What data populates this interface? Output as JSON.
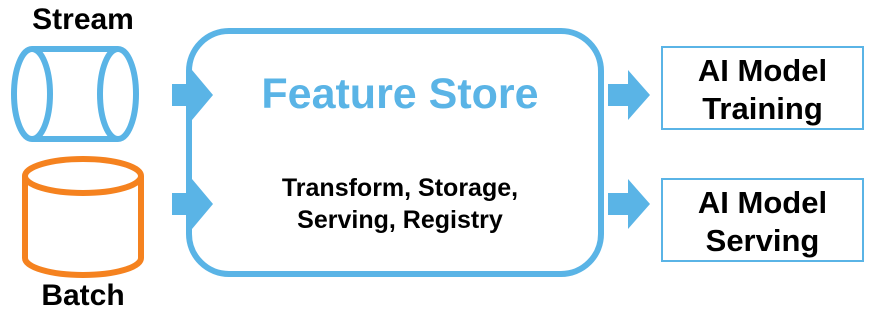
{
  "colors": {
    "stream": "#5ab4e6",
    "batch": "#f5821f",
    "feature_store": "#5ab4e6",
    "arrow": "#5ab4e6",
    "output_border": "#5ab4e6"
  },
  "inputs": {
    "stream_label": "Stream",
    "batch_label": "Batch"
  },
  "feature_store": {
    "title": "Feature Store",
    "desc_line1": "Transform, Storage,",
    "desc_line2": "Serving, Registry"
  },
  "outputs": {
    "training": {
      "line1": "AI Model",
      "line2": "Training"
    },
    "serving": {
      "line1": "AI Model",
      "line2": "Serving"
    }
  },
  "icons": [
    "stream-cylinder-icon",
    "batch-cylinder-icon",
    "arrow-right-icon"
  ]
}
